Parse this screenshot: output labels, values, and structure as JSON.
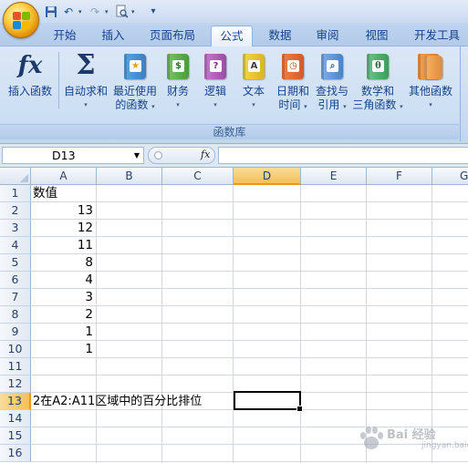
{
  "quick_access": {
    "icons": [
      "save-icon",
      "undo-icon",
      "redo-icon",
      "print-preview-icon",
      "customize-icon"
    ],
    "undo_glyph": "↶",
    "redo_glyph": "↷",
    "dropdown_glyph": "▾",
    "customize_glyph": "▾"
  },
  "tabs": [
    {
      "label": "开始",
      "active": false
    },
    {
      "label": "插入",
      "active": false
    },
    {
      "label": "页面布局",
      "active": false
    },
    {
      "label": "公式",
      "active": true
    },
    {
      "label": "数据",
      "active": false
    },
    {
      "label": "审阅",
      "active": false
    },
    {
      "label": "视图",
      "active": false
    },
    {
      "label": "开发工具",
      "active": false
    }
  ],
  "ribbon": {
    "group_label": "函数库",
    "insert_function": {
      "glyph": "fx",
      "label": "插入函数"
    },
    "autosum": {
      "glyph": "Σ",
      "line1": "自动求和",
      "arrow": "▾"
    },
    "recent": {
      "line1": "最近使用",
      "line2": "的函数",
      "arrow": "▾",
      "badge": "★"
    },
    "financial": {
      "line1": "财务",
      "arrow": "▾",
      "badge": "$"
    },
    "logical": {
      "line1": "逻辑",
      "arrow": "▾",
      "badge": "?"
    },
    "text": {
      "line1": "文本",
      "arrow": "▾",
      "badge": "A"
    },
    "datetime": {
      "line1": "日期和",
      "line2": "时间",
      "arrow": "▾",
      "badge": "◷"
    },
    "lookup": {
      "line1": "查找与",
      "line2": "引用",
      "arrow": "▾",
      "badge": "⌕"
    },
    "math": {
      "line1": "数学和",
      "line2": "三角函数",
      "arrow": "▾",
      "badge": "θ"
    },
    "more": {
      "line1": "其他函数",
      "arrow": "▾"
    }
  },
  "formula_bar": {
    "name_box": "D13",
    "name_dropdown": "▼",
    "fx_label": "fx",
    "formula": ""
  },
  "sheet": {
    "columns": [
      "A",
      "B",
      "C",
      "D",
      "E",
      "F",
      "G"
    ],
    "selected_column": "D",
    "rows": [
      "1",
      "2",
      "3",
      "4",
      "5",
      "6",
      "7",
      "8",
      "9",
      "10",
      "11",
      "12",
      "13",
      "14",
      "15",
      "16"
    ],
    "selected_row": "13",
    "cells": {
      "A1": "数值",
      "A2": "13",
      "A3": "12",
      "A4": "11",
      "A5": "8",
      "A6": "4",
      "A7": "3",
      "A8": "2",
      "A9": "1",
      "A10": "1",
      "A13": "2在A2:A11区域中的百分比排位"
    },
    "active_cell": "D13"
  },
  "watermark": {
    "text": "Bai 经验",
    "sub": "jingyan.baidu.com"
  }
}
